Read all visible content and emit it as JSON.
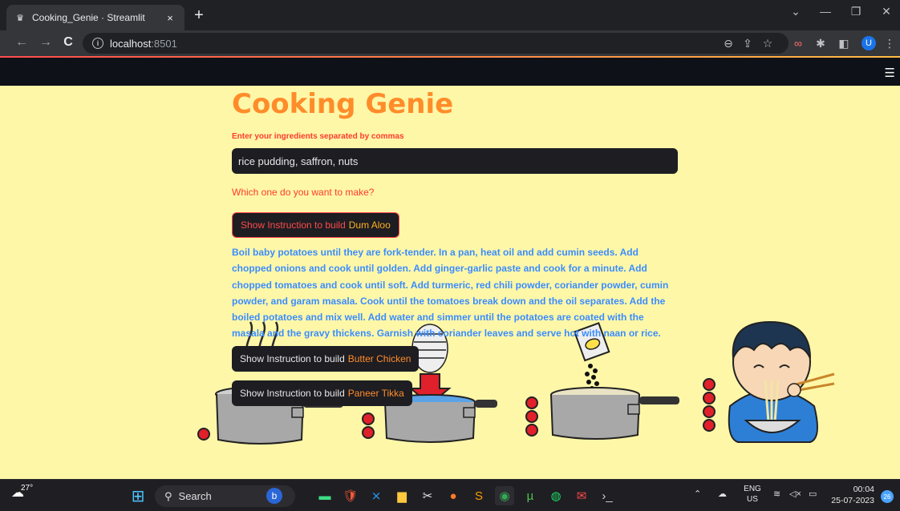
{
  "browser": {
    "tab_title": "Cooking_Genie · Streamlit",
    "tab_close": "×",
    "new_tab": "+",
    "url_host": "localhost",
    "url_port": ":8501"
  },
  "app": {
    "title": "Cooking Genie",
    "input_label": "Enter your ingredients separated by commas",
    "input_value": "rice pudding, saffron, nuts",
    "question": "Which one do you want to make?",
    "button_prefix": "Show Instruction to build",
    "recipes": [
      {
        "name": "Dum Aloo"
      },
      {
        "name": "Butter Chicken"
      },
      {
        "name": "Paneer Tikka"
      }
    ],
    "instructions": "Boil baby potatoes until they are fork-tender. In a pan, heat oil and add cumin seeds. Add chopped onions and cook until golden. Add ginger-garlic paste and cook for a minute. Add chopped tomatoes and cook until soft. Add turmeric, red chili powder, coriander powder, cumin powder, and garam masala. Cook until the tomatoes break down and the oil separates. Add the boiled potatoes and mix well. Add water and simmer until the potatoes are coated with the masala and the gravy thickens. Garnish with coriander leaves and serve hot with naan or rice."
  },
  "taskbar": {
    "temperature": "27°",
    "search_placeholder": "Search",
    "lang_line1": "ENG",
    "lang_line2": "US",
    "time": "00:04",
    "date": "25-07-2023",
    "notification_count": "26"
  },
  "profile": {
    "initial": "U"
  },
  "colors": {
    "app_bg": "#fff7a8",
    "title": "#ff8c2a",
    "label": "#ff3b2f",
    "instructions": "#3a8dff",
    "button_bg": "#1d1d22"
  }
}
